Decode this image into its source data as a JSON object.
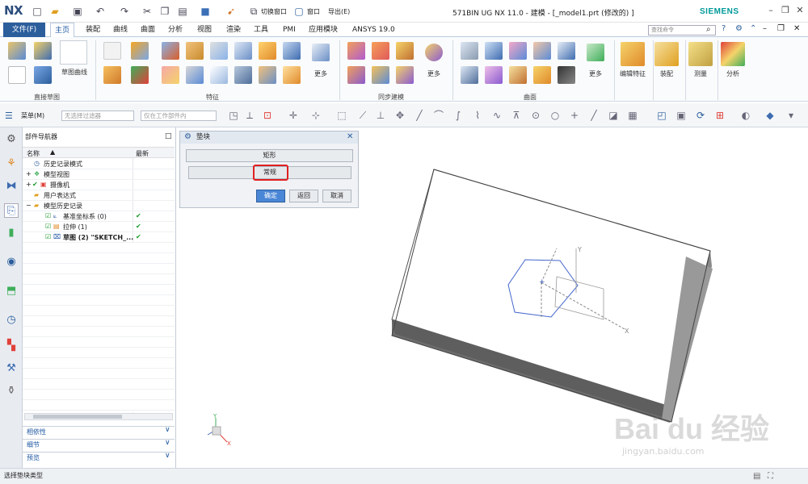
{
  "app": {
    "logo": "NX",
    "title": "571BIN UG NX 11.0 - 建模 - [_model1.prt  (修改的) ]",
    "brand": "SIEMENS",
    "quick_switch_label": "切换窗口",
    "window_label": "窗口",
    "export_label": "导出(E)"
  },
  "tabs": {
    "file": "文件(F)",
    "items": [
      "主页",
      "装配",
      "曲线",
      "曲面",
      "分析",
      "视图",
      "渲染",
      "工具",
      "PMI",
      "应用模块",
      "ANSYS 19.0"
    ]
  },
  "search": {
    "placeholder": "查找命令"
  },
  "ribbon": {
    "groups": [
      "直接草图",
      "特征",
      "同步建模",
      "曲面"
    ],
    "labels": {
      "sketch_curve": "草图曲线",
      "more1": "更多",
      "more2": "更多",
      "more3": "更多",
      "edit_feature": "编辑特征",
      "assembly": "装配",
      "measure": "测量",
      "analysis": "分析"
    }
  },
  "toolbar": {
    "menu": "菜单(M)",
    "filter": "无选择过滤器",
    "scope": "仅在工作部件内"
  },
  "navigator": {
    "title": "部件导航器",
    "col_name": "名称",
    "col_latest": "最新",
    "rows": [
      {
        "label": "历史记录模式"
      },
      {
        "label": "模型视图"
      },
      {
        "label": "摄像机"
      },
      {
        "label": "用户表达式"
      },
      {
        "label": "模型历史记录"
      },
      {
        "label": "基准坐标系 (0)"
      },
      {
        "label": "拉伸 (1)"
      },
      {
        "label": "草图 (2) \"SKETCH_..."
      }
    ],
    "sections": [
      "相依性",
      "细节",
      "预览"
    ]
  },
  "dialog": {
    "title": "垫块",
    "opt1": "矩形",
    "opt2": "常规",
    "ok": "确定",
    "back": "返回",
    "cancel": "取消"
  },
  "status": {
    "text": "选择垫块类型"
  },
  "watermark": {
    "main": "Bai du 经验",
    "sub": "jingyan.baidu.com"
  },
  "colors": {
    "accent": "#2c5e9c",
    "highlight": "#e02020",
    "check": "#1a9a2c"
  }
}
